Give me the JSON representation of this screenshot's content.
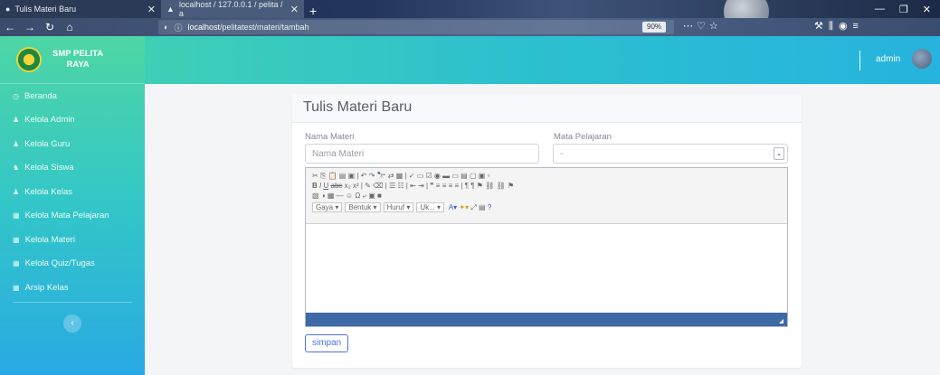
{
  "browser": {
    "tab1_title": "Tulis Materi Baru",
    "tab2_title": "localhost / 127.0.0.1 / pelita / a",
    "url_host": "localhost",
    "url_path": "/pelitatest/materi/tambah",
    "zoom": "90%"
  },
  "brand": {
    "line1": "SMP PELITA",
    "line2": "RAYA"
  },
  "sidebar": {
    "items": [
      {
        "label": "Beranda",
        "icon": "dashboard-icon"
      },
      {
        "label": "Kelola Admin",
        "icon": "user-icon"
      },
      {
        "label": "Kelola Guru",
        "icon": "user-icon"
      },
      {
        "label": "Kelola Siswa",
        "icon": "users-icon"
      },
      {
        "label": "Kelola Kelas",
        "icon": "user-icon"
      },
      {
        "label": "Kelola Mata Pelajaran",
        "icon": "table-icon"
      },
      {
        "label": "Kelola Materi",
        "icon": "table-icon"
      },
      {
        "label": "Kelola Quiz/Tugas",
        "icon": "table-icon"
      },
      {
        "label": "Arsip Kelas",
        "icon": "table-icon"
      }
    ],
    "toggle": "‹"
  },
  "topbar": {
    "user": "admin"
  },
  "card": {
    "title": "Tulis Materi Baru",
    "nama_label": "Nama Materi",
    "nama_placeholder": "Nama Materi",
    "mapel_label": "Mata Pelajaran",
    "mapel_selected": "-",
    "submit": "simpan"
  },
  "editor": {
    "combos": [
      "Gaya",
      "Bentuk",
      "Huruf",
      "Uk..."
    ]
  }
}
